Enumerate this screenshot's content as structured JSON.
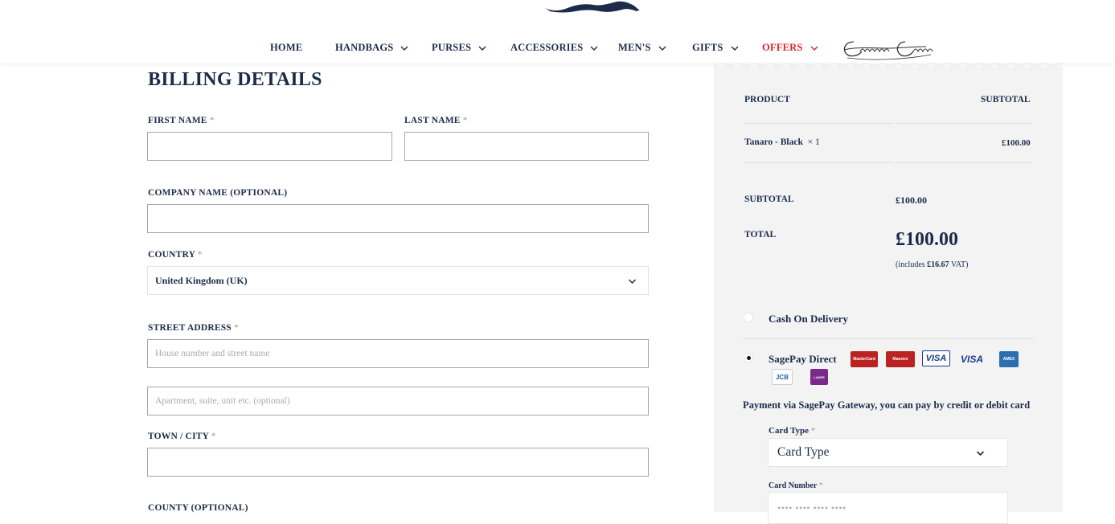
{
  "nav": {
    "items": [
      {
        "label": "HOME",
        "has_dropdown": false
      },
      {
        "label": "HANDBAGS",
        "has_dropdown": true
      },
      {
        "label": "PURSES",
        "has_dropdown": true
      },
      {
        "label": "ACCESSORIES",
        "has_dropdown": true
      },
      {
        "label": "MEN'S",
        "has_dropdown": true
      },
      {
        "label": "GIFTS",
        "has_dropdown": true
      },
      {
        "label": "OFFERS",
        "has_dropdown": true,
        "highlight_color": "#d9262c"
      }
    ],
    "brand_logo_icon": "castellana-couture-script-logo",
    "top_logo_icon": "running-hound-logo"
  },
  "billing": {
    "title": "BILLING DETAILS",
    "first_name_label": "FIRST NAME",
    "last_name_label": "LAST NAME",
    "company_label": "COMPANY NAME (OPTIONAL)",
    "country_label": "COUNTRY",
    "country_value": "United Kingdom (UK)",
    "street_label": "STREET ADDRESS",
    "street_placeholder": "House number and street name",
    "street2_placeholder": "Apartment, suite, unit etc. (optional)",
    "town_label": "TOWN / CITY",
    "county_label": "COUNTY (OPTIONAL)",
    "required_mark": "*"
  },
  "order": {
    "product_header": "PRODUCT",
    "subtotal_header": "SUBTOTAL",
    "product_name": "Tanaro - Black",
    "product_qty": "× 1",
    "product_price": "£100.00",
    "subtotal_label": "SUBTOTAL",
    "subtotal_value": "£100.00",
    "total_label": "TOTAL",
    "total_value": "£100.00",
    "vat_note_prefix": "(includes ",
    "vat_amount": "£16.67",
    "vat_note_suffix": " VAT)"
  },
  "payment": {
    "cod_label": "Cash On Delivery",
    "sagepay_label": "SagePay Direct",
    "selected": "sagepay",
    "description": "Payment via SagePay Gateway, you can pay by credit or debit card",
    "card_type_label": "Card Type",
    "card_type_value": "Card Type",
    "card_number_label": "Card Number",
    "card_number_placeholder": "•••• •••• •••• ••••",
    "card_icons": [
      "mastercard-icon",
      "maestro-icon",
      "visa-debit-icon",
      "visa-icon",
      "amex-icon",
      "jcb-icon",
      "laser-icon"
    ],
    "card_texts": {
      "mastercard": "MasterCard",
      "maestro": "Maestro",
      "visa_debit": "VISA",
      "visa": "VISA",
      "amex": "AMEX",
      "jcb": "JCB",
      "laser": "LASER"
    }
  },
  "colors": {
    "navy": "#1c2b4a",
    "offers_red": "#d9262c",
    "sidebar_bg": "#f3f3f3"
  }
}
